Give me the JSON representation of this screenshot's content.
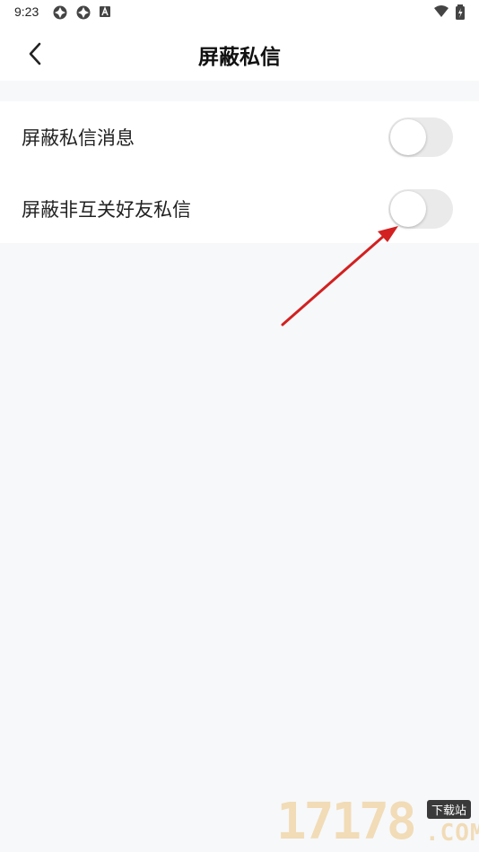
{
  "status_bar": {
    "time": "9:23",
    "icons": [
      "app-notification-icon",
      "app-notification-icon",
      "text-a-icon",
      "wifi-icon",
      "battery-icon"
    ]
  },
  "header": {
    "title": "屏蔽私信",
    "back_icon": "chevron-left-icon"
  },
  "settings": [
    {
      "label": "屏蔽私信消息",
      "enabled": false
    },
    {
      "label": "屏蔽非互关好友私信",
      "enabled": false
    }
  ],
  "colors": {
    "page_background": "#f7f8fa",
    "card_background": "#ffffff",
    "toggle_off_track": "#eaeaea",
    "annotation_arrow": "#d32020"
  },
  "watermark": {
    "digits": "17178",
    "badge": "下载站",
    "domain": ".COM"
  }
}
